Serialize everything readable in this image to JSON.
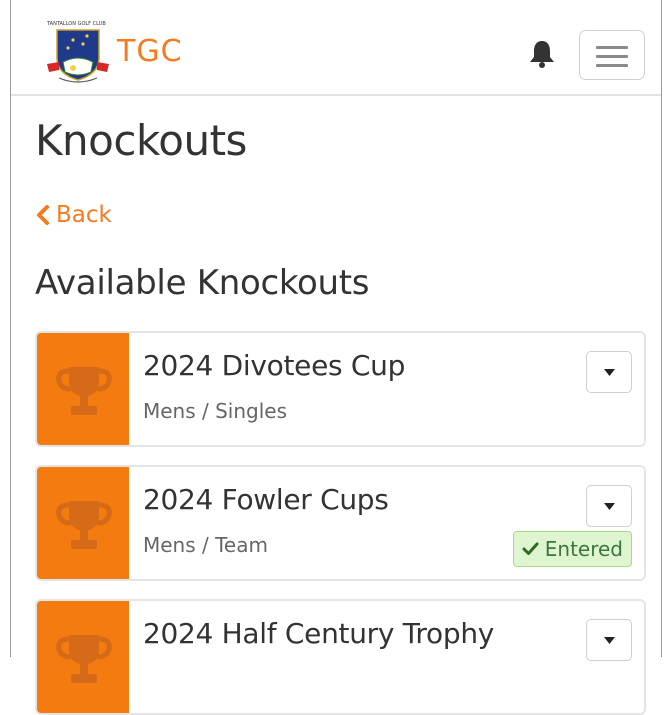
{
  "navbar": {
    "logo_text": "TANTALLON GOLF CLUB",
    "brand": "TGC"
  },
  "page": {
    "title": "Knockouts",
    "back_label": "Back",
    "section_title": "Available Knockouts"
  },
  "knockouts": [
    {
      "title": "2024 Divotees Cup",
      "subtitle": "Mens / Singles",
      "badge": ""
    },
    {
      "title": "2024 Fowler Cups",
      "subtitle": "Mens / Team",
      "badge": "Entered"
    },
    {
      "title": "2024 Half Century Trophy",
      "subtitle": "",
      "badge": ""
    }
  ],
  "icons": {
    "notification": "bell-icon",
    "menu": "hamburger-icon",
    "back": "chevron-left-icon",
    "trophy": "trophy-icon",
    "dropdown": "caret-down-icon",
    "entered": "check-icon"
  },
  "colors": {
    "accent": "#f47b20",
    "thumb": "#f47b10",
    "badge_bg": "#dff5cf",
    "badge_text": "#3c763d"
  }
}
